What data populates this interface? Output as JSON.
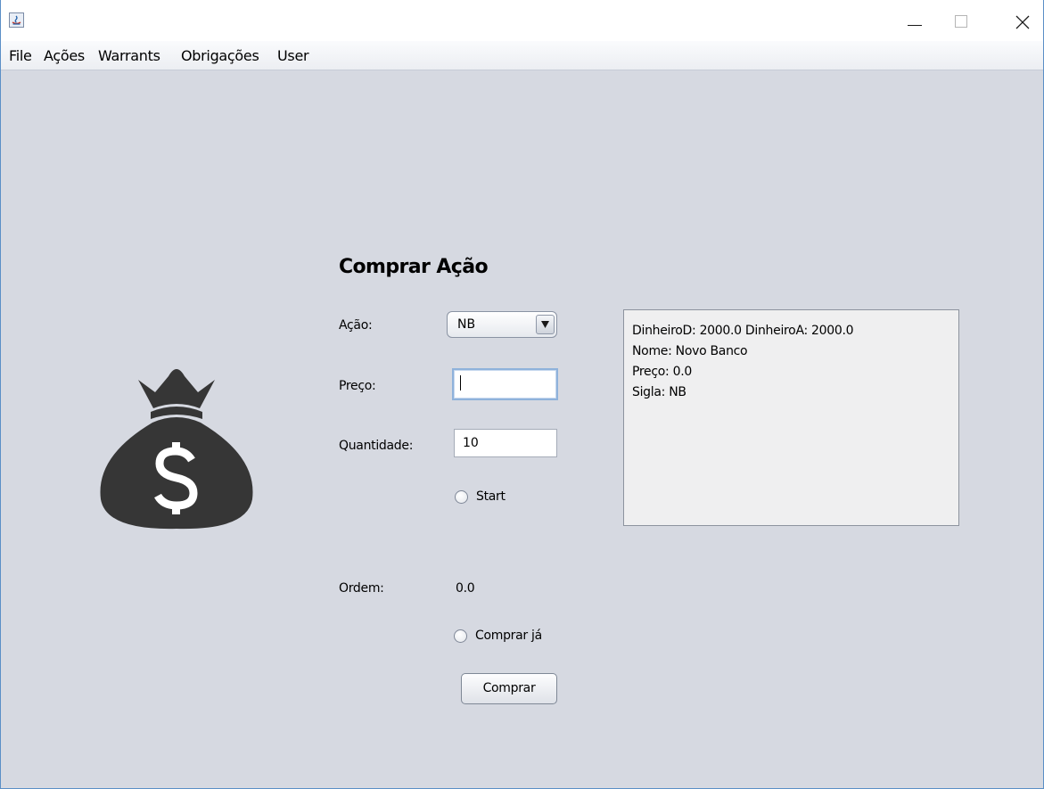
{
  "window": {
    "title": "",
    "controls": {
      "minimize": "minimize-icon",
      "maximize": "maximize-icon",
      "close": "close-icon"
    }
  },
  "menu": {
    "items": [
      {
        "label": "File"
      },
      {
        "label": "Ações"
      },
      {
        "label": "Warrants"
      },
      {
        "label": "Obrigações"
      },
      {
        "label": "User"
      }
    ]
  },
  "form": {
    "heading": "Comprar Ação",
    "acao": {
      "label": "Ação:",
      "selected": "NB"
    },
    "preco": {
      "label": "Preço:",
      "value": ""
    },
    "quantidade": {
      "label": "Quantidade:",
      "value": "10"
    },
    "start": {
      "label": "Start",
      "checked": false
    },
    "ordem": {
      "label": "Ordem:",
      "value": "0.0"
    },
    "comprar_ja": {
      "label": "Comprar já",
      "checked": false
    },
    "submit": {
      "label": "Comprar"
    }
  },
  "info": {
    "lines": [
      "DinheiroD: 2000.0  DinheiroA: 2000.0",
      "Nome: Novo Banco",
      "Preço: 0.0",
      "Sigla: NB"
    ]
  },
  "icons": {
    "illustration": "money-bag-icon",
    "app": "java-app-icon"
  },
  "colors": {
    "content_background": "#d6d9e1",
    "icon_dark": "#363636",
    "panel_background": "#efeff0",
    "focus_border": "#8fb2db"
  }
}
